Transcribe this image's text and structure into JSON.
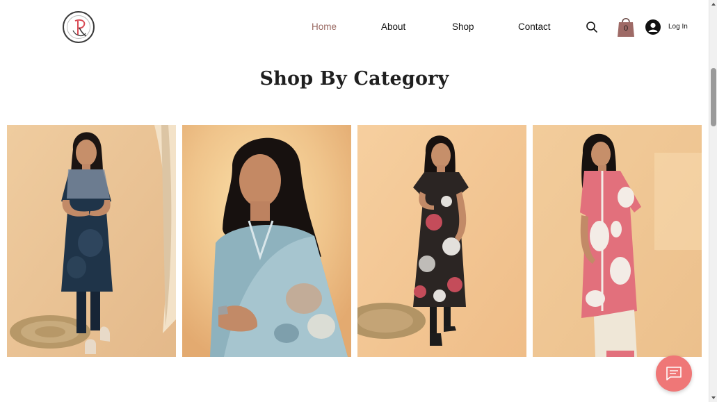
{
  "header": {
    "logo_icon": "brand-logo-icon",
    "nav": [
      {
        "label": "Home",
        "active": true
      },
      {
        "label": "About",
        "active": false
      },
      {
        "label": "Shop",
        "active": false
      },
      {
        "label": "Contact",
        "active": false
      }
    ],
    "search_icon": "search-icon",
    "cart_icon": "shopping-bag-icon",
    "cart_count": "0",
    "avatar_icon": "user-avatar-icon",
    "login_label": "Log In"
  },
  "section": {
    "title": "Shop By Category"
  },
  "categories": [
    {
      "image": "model in navy blue kurta with sheer sleeves and lotus print, navy pants"
    },
    {
      "image": "model in light blue printed silk dupatta set, close portrait"
    },
    {
      "image": "model in black floral print dress with red and white flowers"
    },
    {
      "image": "model in pink and white leaf print kurta with white pants"
    }
  ],
  "chat": {
    "icon": "chat-message-icon"
  },
  "colors": {
    "nav_active": "#9a6a63",
    "cart_bag": "#9e6a66",
    "chat_button": "#ef7777",
    "backdrop_peach": "#efc99d"
  }
}
